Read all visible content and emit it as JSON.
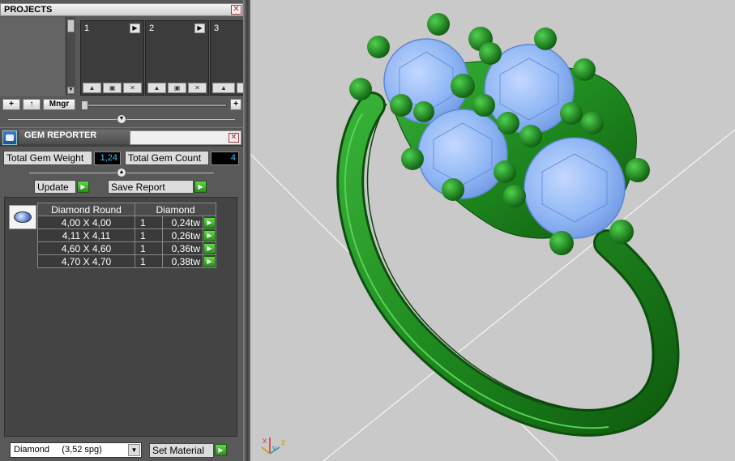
{
  "projects": {
    "title": "PROJECTS",
    "slots": [
      {
        "number": "1"
      },
      {
        "number": "2"
      },
      {
        "number": "3"
      }
    ],
    "toolbar": {
      "add": "+",
      "up": "↑",
      "manager": "Mngr",
      "zoom_plus": "+"
    }
  },
  "gem_reporter": {
    "title": "GEM REPORTER",
    "total_weight_label": "Total Gem Weight",
    "total_weight_value": "1,24",
    "total_count_label": "Total Gem Count",
    "total_count_value": "4",
    "update_label": "Update",
    "save_report_label": "Save Report",
    "table": {
      "col_shape": "Diamond Round",
      "col_material": "Diamond",
      "rows": [
        {
          "size": "4,00 X 4,00",
          "qty": "1",
          "weight": "0,24tw"
        },
        {
          "size": "4,11 X 4,11",
          "qty": "1",
          "weight": "0,26tw"
        },
        {
          "size": "4,60 X 4,60",
          "qty": "1",
          "weight": "0,36tw"
        },
        {
          "size": "4,70 X 4,70",
          "qty": "1",
          "weight": "0,38tw"
        }
      ]
    },
    "material_select": "Diamond     (3,52 spg)",
    "set_material_label": "Set Material"
  },
  "viewport": {
    "axis_labels": {
      "x": "x",
      "y": "y",
      "z": "z"
    },
    "colors": {
      "background": "#c9c9c9",
      "metal": "#1f8a1f",
      "gem": "#8fb6f4"
    }
  }
}
